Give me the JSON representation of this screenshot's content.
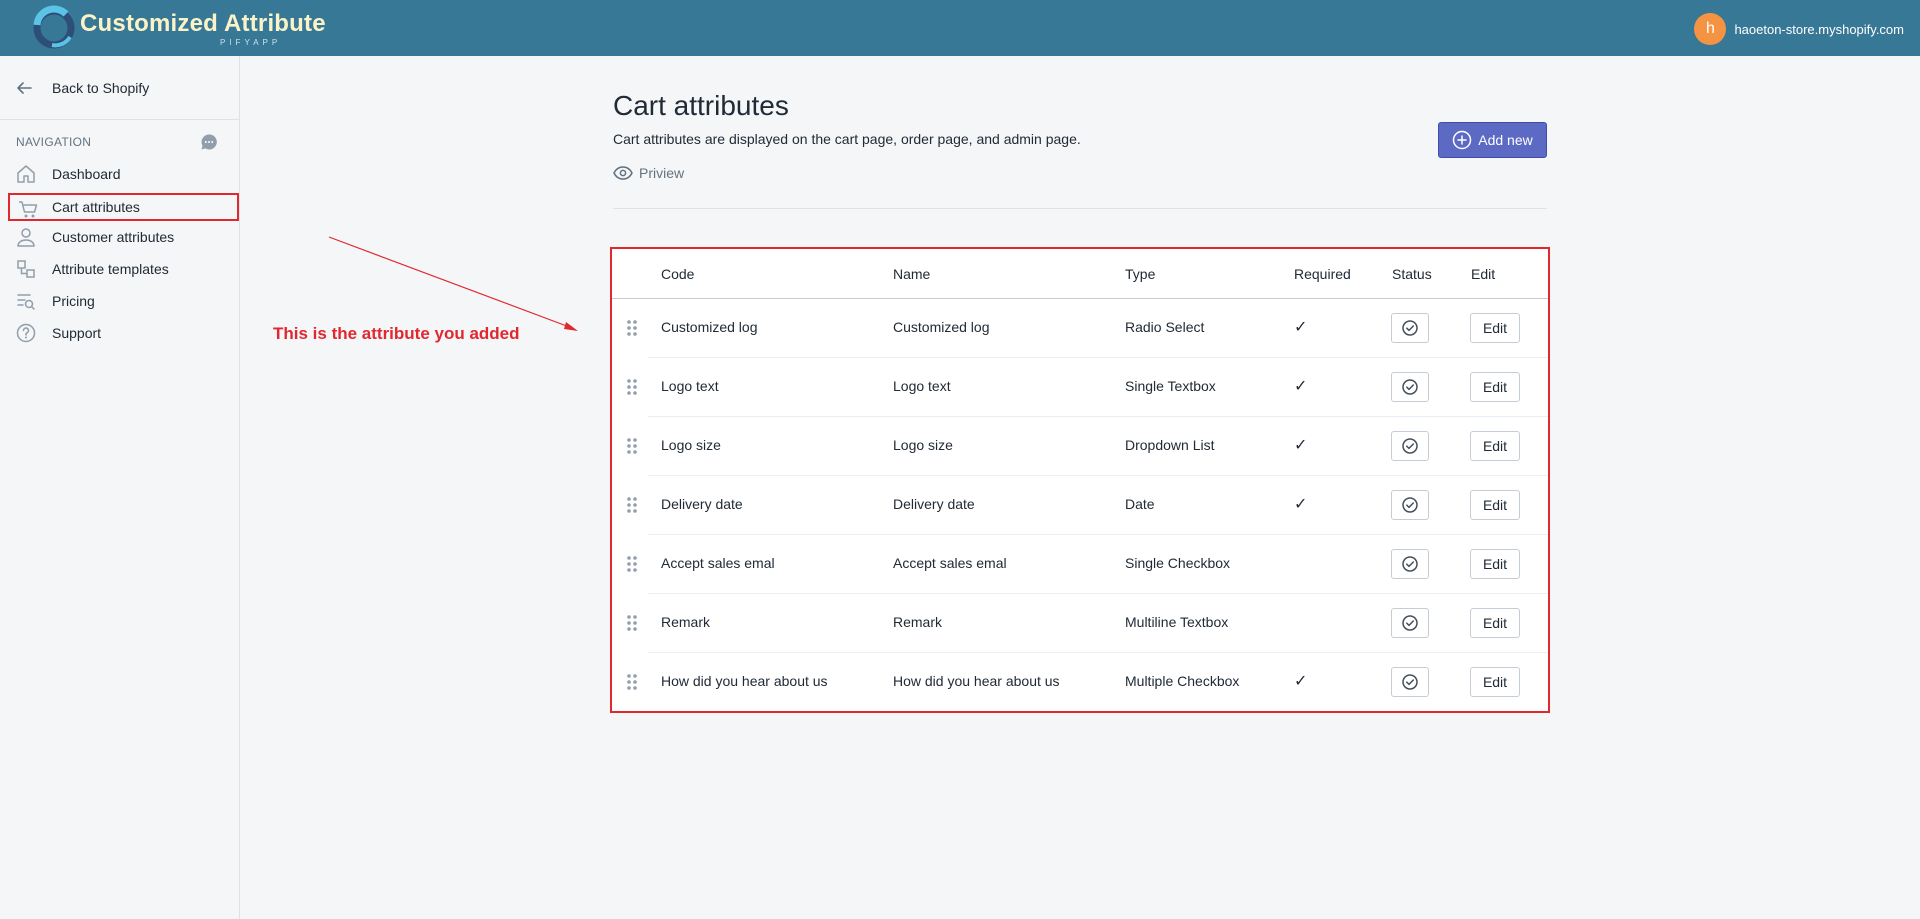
{
  "app": {
    "logo_text": "Customized Attribute",
    "logo_sub": "PIFYAPP"
  },
  "account": {
    "avatar_letter": "h",
    "store_name": "haoeton-store.myshopify.com"
  },
  "sidebar": {
    "back_label": "Back to Shopify",
    "nav_heading": "NAVIGATION",
    "items": [
      {
        "label": "Dashboard",
        "icon": "home-icon"
      },
      {
        "label": "Cart attributes",
        "icon": "cart-icon",
        "active": true
      },
      {
        "label": "Customer attributes",
        "icon": "user-icon"
      },
      {
        "label": "Attribute templates",
        "icon": "templates-icon"
      },
      {
        "label": "Pricing",
        "icon": "pricing-icon"
      },
      {
        "label": "Support",
        "icon": "question-icon"
      }
    ]
  },
  "annotation": {
    "text": "This is the attribute you added",
    "color": "#e0282e"
  },
  "page": {
    "title": "Cart attributes",
    "subtitle": "Cart attributes are displayed on the cart page, order page, and admin page.",
    "preview_label": "Priview",
    "add_button_label": "Add new"
  },
  "table": {
    "headers": {
      "code": "Code",
      "name": "Name",
      "type": "Type",
      "required": "Required",
      "status": "Status",
      "edit": "Edit"
    },
    "rows": [
      {
        "code": "Customized log",
        "name": "Customized log",
        "type": "Radio Select",
        "required": "✓",
        "edit": "Edit"
      },
      {
        "code": "Logo text",
        "name": "Logo text",
        "type": "Single Textbox",
        "required": "✓",
        "edit": "Edit"
      },
      {
        "code": "Logo size",
        "name": "Logo size",
        "type": "Dropdown List",
        "required": "✓",
        "edit": "Edit"
      },
      {
        "code": "Delivery date",
        "name": "Delivery date",
        "type": "Date",
        "required": "✓",
        "edit": "Edit"
      },
      {
        "code": "Accept sales emal",
        "name": "Accept sales emal",
        "type": "Single Checkbox",
        "required": "",
        "edit": "Edit"
      },
      {
        "code": "Remark",
        "name": "Remark",
        "type": "Multiline Textbox",
        "required": "",
        "edit": "Edit"
      },
      {
        "code": "How did you hear about us",
        "name": "How did you hear about us",
        "type": "Multiple Checkbox",
        "required": "✓",
        "edit": "Edit"
      }
    ]
  },
  "colors": {
    "topbar": "#377896",
    "accent": "#5c6ac4",
    "highlight": "#e0282e"
  }
}
